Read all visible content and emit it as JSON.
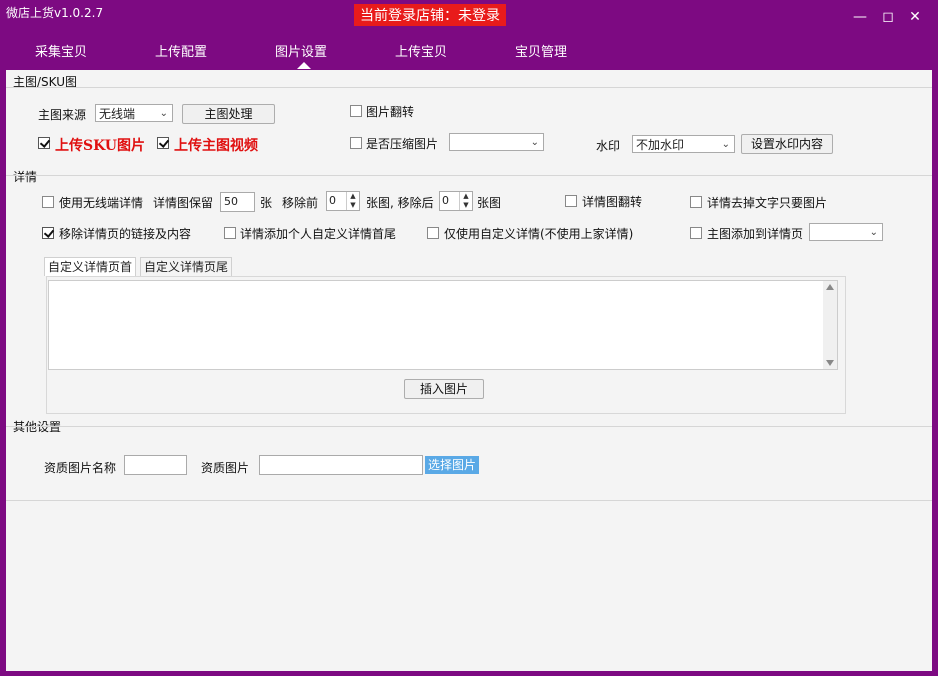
{
  "window": {
    "title": "微店上货v1.0.2.7",
    "login_status": "当前登录店铺：未登录",
    "minimize_icon": "minimize-icon",
    "maximize_icon": "maximize-icon",
    "close_icon": "close-icon"
  },
  "nav": {
    "tabs": [
      {
        "label": "采集宝贝"
      },
      {
        "label": "上传配置"
      },
      {
        "label": "图片设置"
      },
      {
        "label": "上传宝贝"
      },
      {
        "label": "宝贝管理"
      }
    ],
    "active_index": 2
  },
  "main_image": {
    "section_title": "主图/SKU图",
    "source_label": "主图来源",
    "source_value": "无线端",
    "process_button": "主图处理",
    "flip_label": "图片翻转",
    "flip_checked": false,
    "upload_sku_label": "上传SKU图片",
    "upload_sku_checked": true,
    "upload_video_label": "上传主图视频",
    "upload_video_checked": true,
    "compress_label": "是否压缩图片",
    "compress_checked": false,
    "compress_value": "",
    "watermark_label": "水印",
    "watermark_value": "不加水印",
    "watermark_button": "设置水印内容"
  },
  "detail": {
    "section_title": "详情",
    "use_wireless_label": "使用无线端详情",
    "use_wireless_checked": false,
    "keep_label": "详情图保留",
    "keep_value": "50",
    "keep_unit": "张",
    "remove_before_label": "移除前",
    "remove_before_value": "0",
    "remove_after_label": "张图, 移除后",
    "remove_after_value": "0",
    "remove_after_unit": "张图",
    "flip_label": "详情图翻转",
    "flip_checked": false,
    "remove_text_label": "详情去掉文字只要图片",
    "remove_text_checked": false,
    "remove_links_label": "移除详情页的链接及内容",
    "remove_links_checked": true,
    "add_custom_label": "详情添加个人自定义详情首尾",
    "add_custom_checked": false,
    "only_custom_label": "仅使用自定义详情(不使用上家详情)",
    "only_custom_checked": false,
    "main_to_detail_label": "主图添加到详情页",
    "main_to_detail_checked": false,
    "main_to_detail_value": "",
    "subtabs": [
      {
        "label": "自定义详情页首"
      },
      {
        "label": "自定义详情页尾"
      }
    ],
    "textarea_value": "",
    "insert_image_button": "插入图片"
  },
  "other": {
    "section_title": "其他设置",
    "qual_name_label": "资质图片名称",
    "qual_name_value": "",
    "qual_image_label": "资质图片",
    "qual_image_value": "",
    "choose_button": "选择图片"
  }
}
